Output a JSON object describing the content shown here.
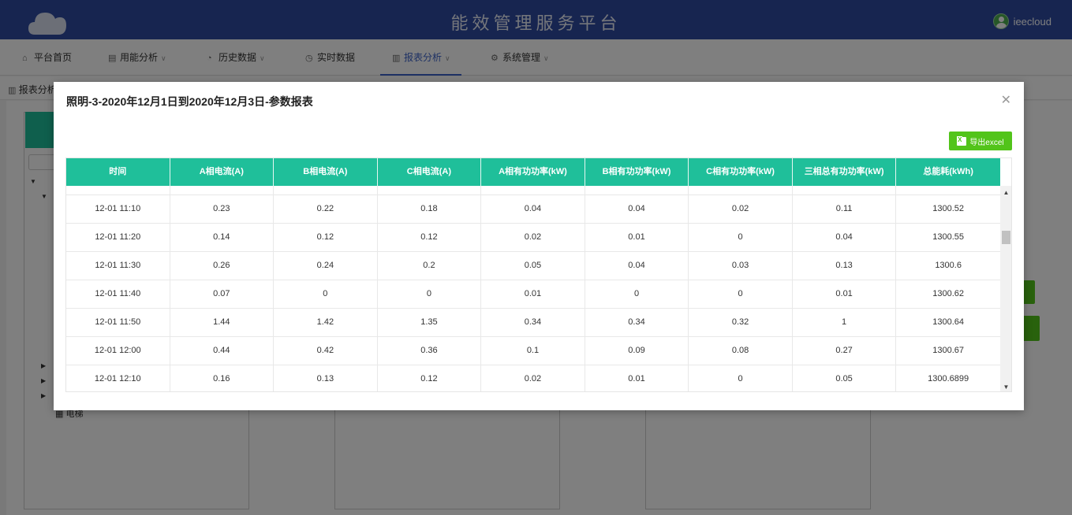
{
  "header": {
    "title": "能效管理服务平台",
    "username": "ieecloud"
  },
  "nav": {
    "items": [
      {
        "label": "平台首页",
        "icon": "home-icon"
      },
      {
        "label": "用能分析",
        "icon": "list-icon"
      },
      {
        "label": "历史数据",
        "icon": "dashboard-icon"
      },
      {
        "label": "实时数据",
        "icon": "clock-icon"
      },
      {
        "label": "报表分析",
        "icon": "bar-chart-icon"
      },
      {
        "label": "系统管理",
        "icon": "gear-icon"
      }
    ]
  },
  "breadcrumb": {
    "label": "报表分析"
  },
  "background": {
    "tree_label": "电梯"
  },
  "modal": {
    "title": "照明-3-2020年12月1日到2020年12月3日-参数报表",
    "export_label": "导出excel",
    "columns": [
      "时间",
      "A相电流(A)",
      "B相电流(A)",
      "C相电流(A)",
      "A相有功功率(kW)",
      "B相有功功率(kW)",
      "C相有功功率(kW)",
      "三相总有功功率(kW)",
      "总能耗(kWh)"
    ],
    "rows": [
      [
        "12-01 11:10",
        "0.23",
        "0.22",
        "0.18",
        "0.04",
        "0.04",
        "0.02",
        "0.11",
        "1300.52"
      ],
      [
        "12-01 11:20",
        "0.14",
        "0.12",
        "0.12",
        "0.02",
        "0.01",
        "0",
        "0.04",
        "1300.55"
      ],
      [
        "12-01 11:30",
        "0.26",
        "0.24",
        "0.2",
        "0.05",
        "0.04",
        "0.03",
        "0.13",
        "1300.6"
      ],
      [
        "12-01 11:40",
        "0.07",
        "0",
        "0",
        "0.01",
        "0",
        "0",
        "0.01",
        "1300.62"
      ],
      [
        "12-01 11:50",
        "1.44",
        "1.42",
        "1.35",
        "0.34",
        "0.34",
        "0.32",
        "1",
        "1300.64"
      ],
      [
        "12-01 12:00",
        "0.44",
        "0.42",
        "0.36",
        "0.1",
        "0.09",
        "0.08",
        "0.27",
        "1300.67"
      ],
      [
        "12-01 12:10",
        "0.16",
        "0.13",
        "0.12",
        "0.02",
        "0.01",
        "0",
        "0.05",
        "1300.6899"
      ]
    ]
  },
  "colors": {
    "header_bg": "#2f4aa0",
    "table_header_bg": "#1fbf9a",
    "export_button_bg": "#52c41a",
    "nav_active": "#3c62c8"
  }
}
